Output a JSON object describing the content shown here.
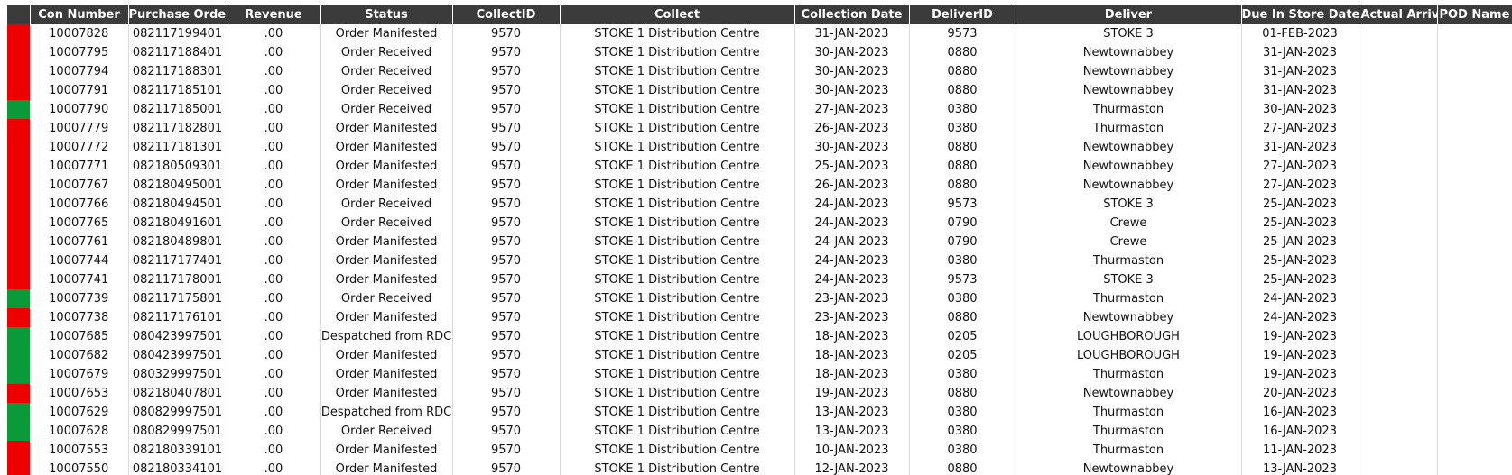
{
  "table": {
    "columns": [
      "",
      "Con Number",
      "Purchase Order",
      "Revenue",
      "Status",
      "CollectID",
      "Collect",
      "Collection Date",
      "DeliverID",
      "Deliver",
      "Due In Store Date",
      "Actual Arrival",
      "POD Name"
    ],
    "colors": {
      "red": "#ee0000",
      "green": "#0a9a3a",
      "header_bg": "#3b3b3b"
    },
    "rows": [
      {
        "flag": "red",
        "con": "10007828",
        "po": "082117199401",
        "revenue": ".00",
        "status": "Order Manifested",
        "collect_id": "9570",
        "collect": "STOKE 1 Distribution Centre",
        "collection_date": "31-JAN-2023",
        "deliver_id": "9573",
        "deliver": "STOKE 3",
        "due": "01-FEB-2023"
      },
      {
        "flag": "red",
        "con": "10007795",
        "po": "082117188401",
        "revenue": ".00",
        "status": "Order Received",
        "collect_id": "9570",
        "collect": "STOKE 1 Distribution Centre",
        "collection_date": "30-JAN-2023",
        "deliver_id": "0880",
        "deliver": "Newtownabbey",
        "due": "31-JAN-2023"
      },
      {
        "flag": "red",
        "con": "10007794",
        "po": "082117188301",
        "revenue": ".00",
        "status": "Order Received",
        "collect_id": "9570",
        "collect": "STOKE 1 Distribution Centre",
        "collection_date": "30-JAN-2023",
        "deliver_id": "0880",
        "deliver": "Newtownabbey",
        "due": "31-JAN-2023"
      },
      {
        "flag": "red",
        "con": "10007791",
        "po": "082117185101",
        "revenue": ".00",
        "status": "Order Received",
        "collect_id": "9570",
        "collect": "STOKE 1 Distribution Centre",
        "collection_date": "30-JAN-2023",
        "deliver_id": "0880",
        "deliver": "Newtownabbey",
        "due": "31-JAN-2023"
      },
      {
        "flag": "green",
        "con": "10007790",
        "po": "082117185001",
        "revenue": ".00",
        "status": "Order Received",
        "collect_id": "9570",
        "collect": "STOKE 1 Distribution Centre",
        "collection_date": "27-JAN-2023",
        "deliver_id": "0380",
        "deliver": "Thurmaston",
        "due": "30-JAN-2023"
      },
      {
        "flag": "red",
        "con": "10007779",
        "po": "082117182801",
        "revenue": ".00",
        "status": "Order Manifested",
        "collect_id": "9570",
        "collect": "STOKE 1 Distribution Centre",
        "collection_date": "26-JAN-2023",
        "deliver_id": "0380",
        "deliver": "Thurmaston",
        "due": "27-JAN-2023"
      },
      {
        "flag": "red",
        "con": "10007772",
        "po": "082117181301",
        "revenue": ".00",
        "status": "Order Manifested",
        "collect_id": "9570",
        "collect": "STOKE 1 Distribution Centre",
        "collection_date": "30-JAN-2023",
        "deliver_id": "0880",
        "deliver": "Newtownabbey",
        "due": "31-JAN-2023"
      },
      {
        "flag": "red",
        "con": "10007771",
        "po": "082180509301",
        "revenue": ".00",
        "status": "Order Manifested",
        "collect_id": "9570",
        "collect": "STOKE 1 Distribution Centre",
        "collection_date": "25-JAN-2023",
        "deliver_id": "0880",
        "deliver": "Newtownabbey",
        "due": "27-JAN-2023"
      },
      {
        "flag": "red",
        "con": "10007767",
        "po": "082180495001",
        "revenue": ".00",
        "status": "Order Manifested",
        "collect_id": "9570",
        "collect": "STOKE 1 Distribution Centre",
        "collection_date": "26-JAN-2023",
        "deliver_id": "0880",
        "deliver": "Newtownabbey",
        "due": "27-JAN-2023"
      },
      {
        "flag": "red",
        "con": "10007766",
        "po": "082180494501",
        "revenue": ".00",
        "status": "Order Received",
        "collect_id": "9570",
        "collect": "STOKE 1 Distribution Centre",
        "collection_date": "24-JAN-2023",
        "deliver_id": "9573",
        "deliver": "STOKE 3",
        "due": "25-JAN-2023"
      },
      {
        "flag": "red",
        "con": "10007765",
        "po": "082180491601",
        "revenue": ".00",
        "status": "Order Received",
        "collect_id": "9570",
        "collect": "STOKE 1 Distribution Centre",
        "collection_date": "24-JAN-2023",
        "deliver_id": "0790",
        "deliver": "Crewe",
        "due": "25-JAN-2023"
      },
      {
        "flag": "red",
        "con": "10007761",
        "po": "082180489801",
        "revenue": ".00",
        "status": "Order Manifested",
        "collect_id": "9570",
        "collect": "STOKE 1 Distribution Centre",
        "collection_date": "24-JAN-2023",
        "deliver_id": "0790",
        "deliver": "Crewe",
        "due": "25-JAN-2023"
      },
      {
        "flag": "red",
        "con": "10007744",
        "po": "082117177401",
        "revenue": ".00",
        "status": "Order Manifested",
        "collect_id": "9570",
        "collect": "STOKE 1 Distribution Centre",
        "collection_date": "24-JAN-2023",
        "deliver_id": "0380",
        "deliver": "Thurmaston",
        "due": "25-JAN-2023"
      },
      {
        "flag": "red",
        "con": "10007741",
        "po": "082117178001",
        "revenue": ".00",
        "status": "Order Manifested",
        "collect_id": "9570",
        "collect": "STOKE 1 Distribution Centre",
        "collection_date": "24-JAN-2023",
        "deliver_id": "9573",
        "deliver": "STOKE 3",
        "due": "25-JAN-2023"
      },
      {
        "flag": "green",
        "con": "10007739",
        "po": "082117175801",
        "revenue": ".00",
        "status": "Order Received",
        "collect_id": "9570",
        "collect": "STOKE 1 Distribution Centre",
        "collection_date": "23-JAN-2023",
        "deliver_id": "0380",
        "deliver": "Thurmaston",
        "due": "24-JAN-2023"
      },
      {
        "flag": "red",
        "con": "10007738",
        "po": "082117176101",
        "revenue": ".00",
        "status": "Order Manifested",
        "collect_id": "9570",
        "collect": "STOKE 1 Distribution Centre",
        "collection_date": "23-JAN-2023",
        "deliver_id": "0880",
        "deliver": "Newtownabbey",
        "due": "24-JAN-2023"
      },
      {
        "flag": "green",
        "con": "10007685",
        "po": "080423997501",
        "revenue": ".00",
        "status": "Despatched from RDC",
        "collect_id": "9570",
        "collect": "STOKE 1 Distribution Centre",
        "collection_date": "18-JAN-2023",
        "deliver_id": "0205",
        "deliver": "LOUGHBOROUGH",
        "due": "19-JAN-2023"
      },
      {
        "flag": "green",
        "con": "10007682",
        "po": "080423997501",
        "revenue": ".00",
        "status": "Order Manifested",
        "collect_id": "9570",
        "collect": "STOKE 1 Distribution Centre",
        "collection_date": "18-JAN-2023",
        "deliver_id": "0205",
        "deliver": "LOUGHBOROUGH",
        "due": "19-JAN-2023"
      },
      {
        "flag": "green",
        "con": "10007679",
        "po": "080329997501",
        "revenue": ".00",
        "status": "Order Manifested",
        "collect_id": "9570",
        "collect": "STOKE 1 Distribution Centre",
        "collection_date": "18-JAN-2023",
        "deliver_id": "0380",
        "deliver": "Thurmaston",
        "due": "19-JAN-2023"
      },
      {
        "flag": "red",
        "con": "10007653",
        "po": "082180407801",
        "revenue": ".00",
        "status": "Order Manifested",
        "collect_id": "9570",
        "collect": "STOKE 1 Distribution Centre",
        "collection_date": "19-JAN-2023",
        "deliver_id": "0880",
        "deliver": "Newtownabbey",
        "due": "20-JAN-2023"
      },
      {
        "flag": "green",
        "con": "10007629",
        "po": "080829997501",
        "revenue": ".00",
        "status": "Despatched from RDC",
        "collect_id": "9570",
        "collect": "STOKE 1 Distribution Centre",
        "collection_date": "13-JAN-2023",
        "deliver_id": "0380",
        "deliver": "Thurmaston",
        "due": "16-JAN-2023"
      },
      {
        "flag": "green",
        "con": "10007628",
        "po": "080829997501",
        "revenue": ".00",
        "status": "Order Received",
        "collect_id": "9570",
        "collect": "STOKE 1 Distribution Centre",
        "collection_date": "13-JAN-2023",
        "deliver_id": "0380",
        "deliver": "Thurmaston",
        "due": "16-JAN-2023"
      },
      {
        "flag": "red",
        "con": "10007553",
        "po": "082180339101",
        "revenue": ".00",
        "status": "Order Manifested",
        "collect_id": "9570",
        "collect": "STOKE 1 Distribution Centre",
        "collection_date": "10-JAN-2023",
        "deliver_id": "0380",
        "deliver": "Thurmaston",
        "due": "11-JAN-2023"
      },
      {
        "flag": "red",
        "con": "10007550",
        "po": "082180334101",
        "revenue": ".00",
        "status": "Order Manifested",
        "collect_id": "9570",
        "collect": "STOKE 1 Distribution Centre",
        "collection_date": "12-JAN-2023",
        "deliver_id": "0880",
        "deliver": "Newtownabbey",
        "due": "13-JAN-2023"
      }
    ]
  }
}
